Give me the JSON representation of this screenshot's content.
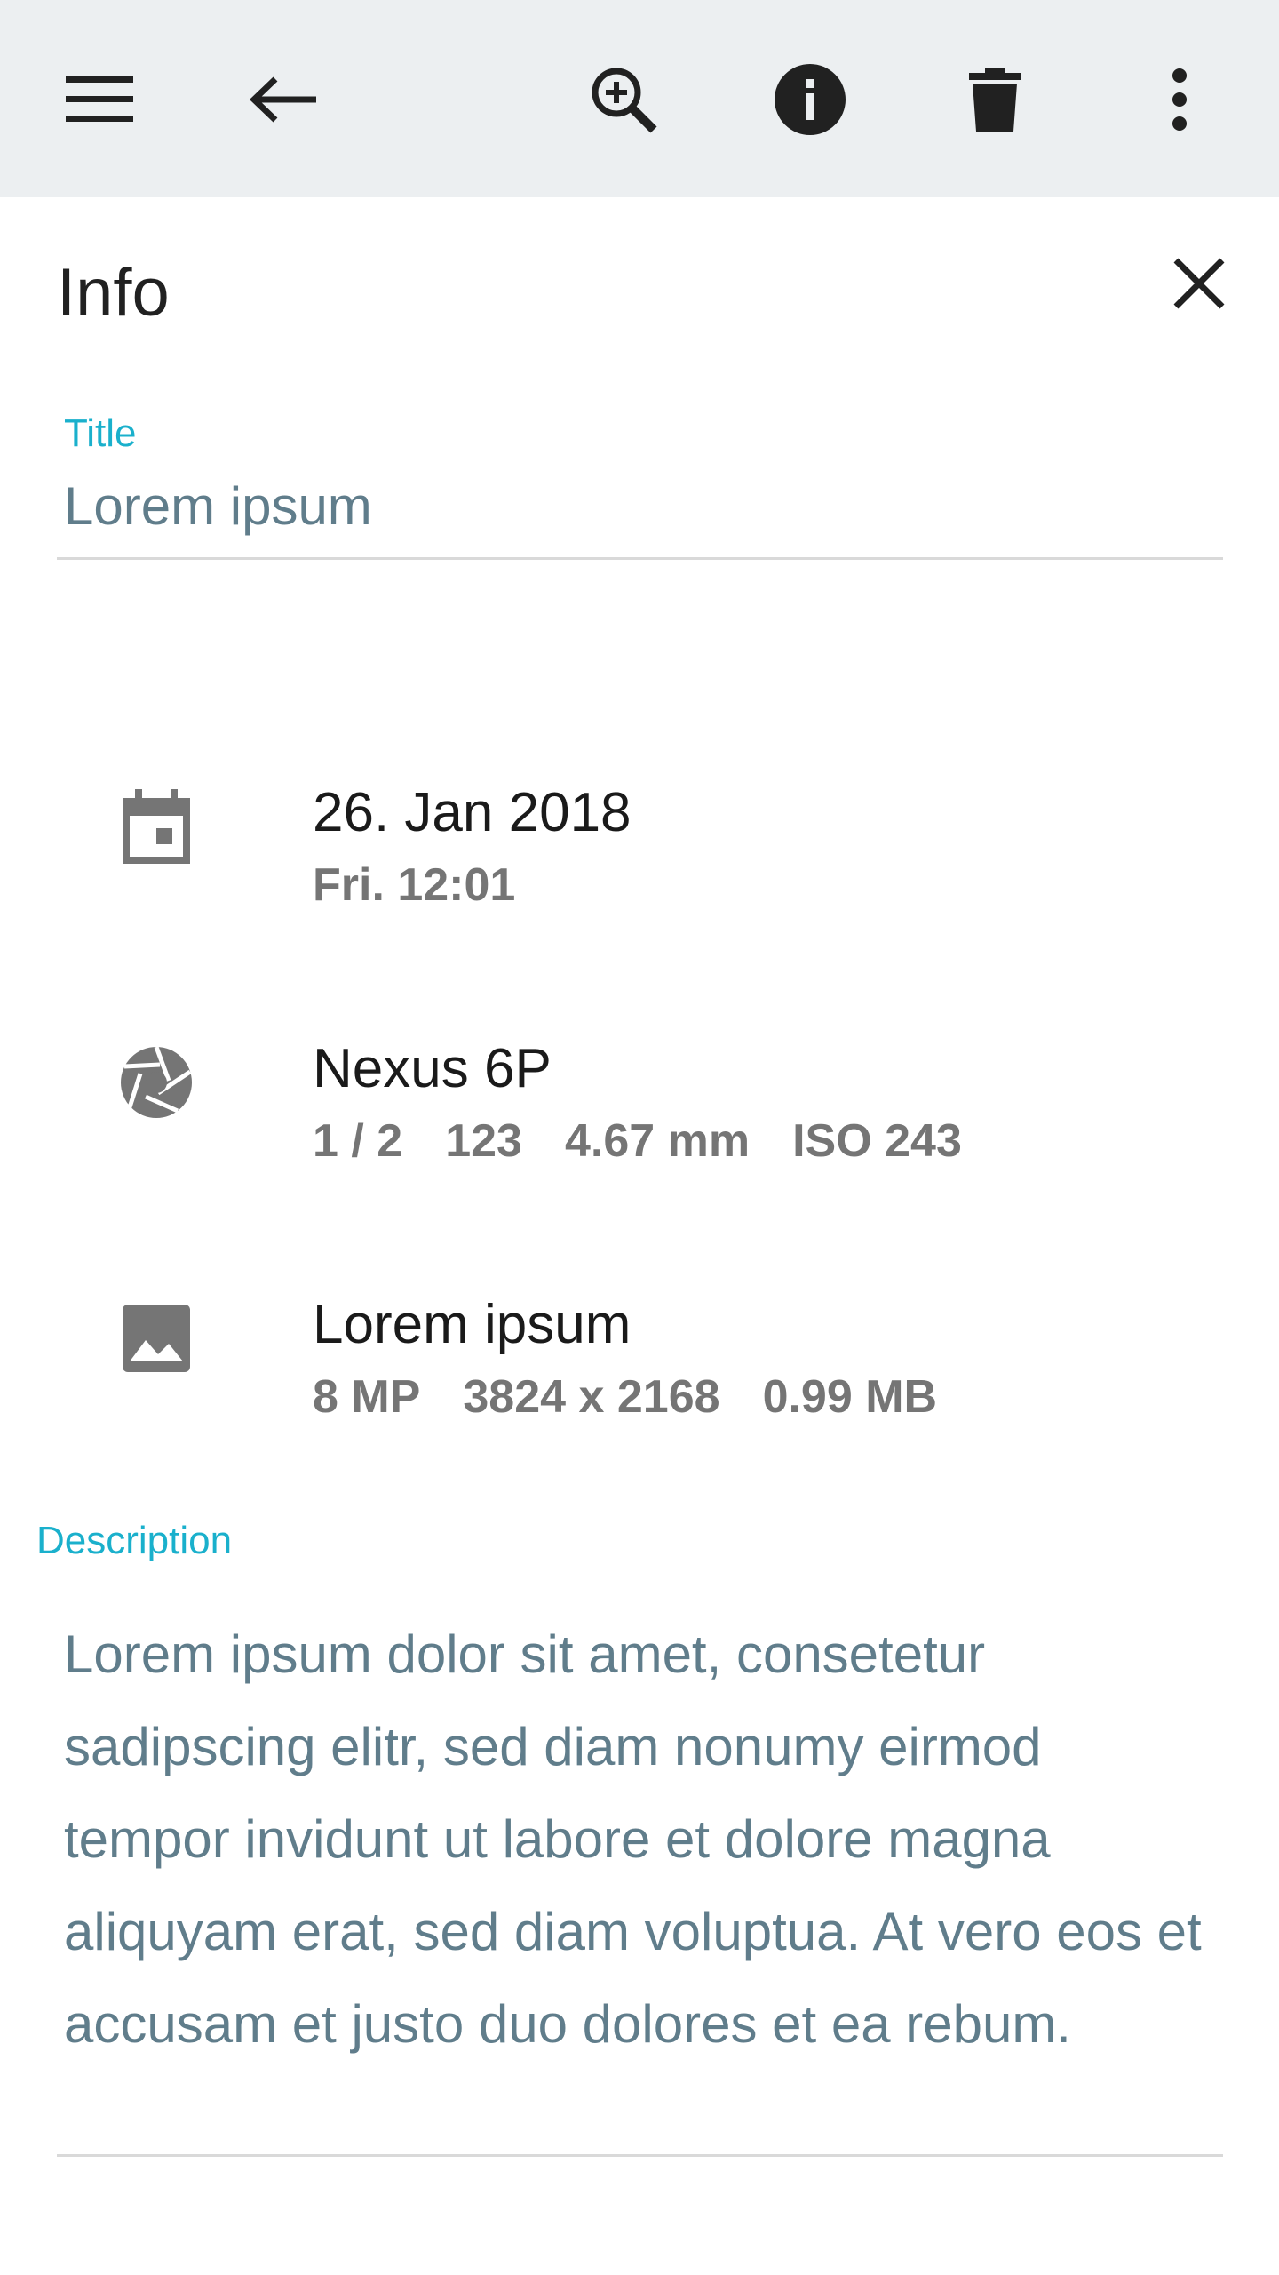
{
  "toolbar": {
    "icons": [
      "menu-icon",
      "back-arrow-icon",
      "zoom-in-icon",
      "info-icon",
      "delete-icon",
      "more-vert-icon"
    ]
  },
  "info_panel": {
    "heading": "Info",
    "title_field": {
      "label": "Title",
      "value": "Lorem ipsum"
    },
    "date_row": {
      "primary": "26. Jan 2018",
      "secondary": "Fri. 12:01"
    },
    "camera_row": {
      "primary": "Nexus 6P",
      "secondary": [
        "1 / 2",
        "123",
        "4.67 mm",
        "ISO 243"
      ]
    },
    "image_row": {
      "primary": "Lorem ipsum",
      "secondary": [
        "8 MP",
        "3824 x 2168",
        "0.99 MB"
      ]
    },
    "description_field": {
      "label": "Description",
      "value": "Lorem ipsum dolor sit amet, consetetur sadipscing elitr, sed diam nonumy eirmod tempor invidunt ut labore et dolore magna aliquyam erat, sed diam voluptua. At vero eos et accusam et justo duo dolores et ea rebum."
    }
  },
  "colors": {
    "toolbar_bg": "#eceff1",
    "accent": "#1ab0cc",
    "field_text": "#607d8b",
    "secondary_text": "#757575",
    "icon_gray": "#757575"
  }
}
